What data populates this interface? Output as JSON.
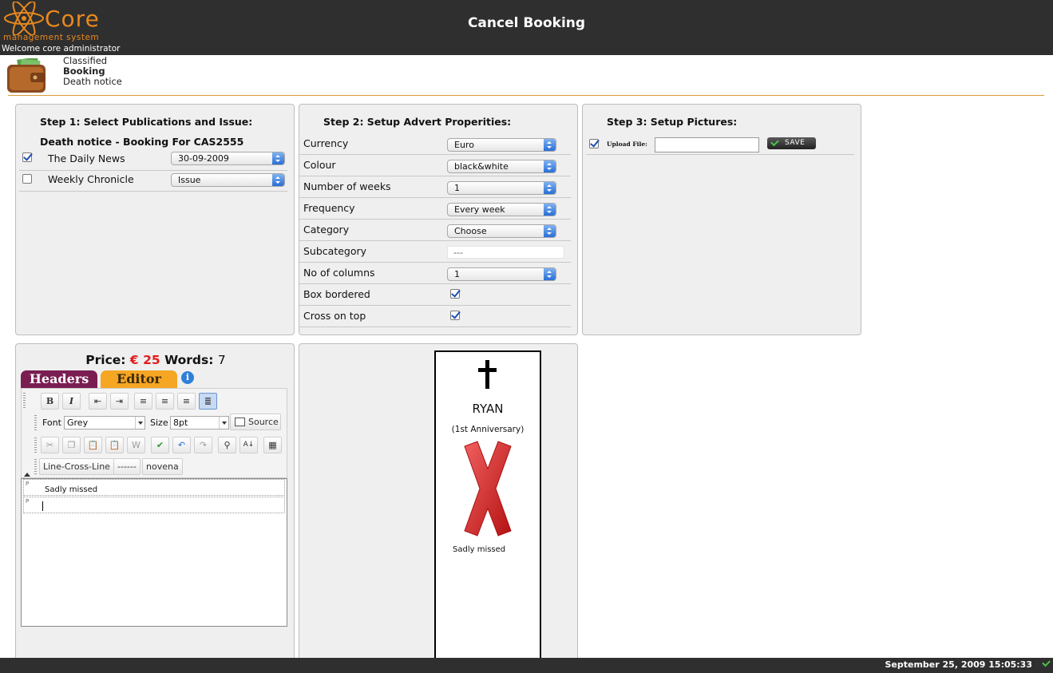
{
  "header": {
    "logo_text": "Core",
    "logo_subtitle": "management system",
    "welcome": "Welcome core administrator",
    "page_title": "Cancel Booking"
  },
  "breadcrumb": {
    "items": [
      "Classified",
      "Booking",
      "Death notice"
    ],
    "active_index": 1
  },
  "step1": {
    "title": "Step 1: Select Publications and Issue:",
    "subtitle": "Death notice - Booking For CAS2555",
    "publications": [
      {
        "name": "The Daily News",
        "checked": true,
        "issue": "30-09-2009"
      },
      {
        "name": "Weekly Chronicle",
        "checked": false,
        "issue": "Issue"
      }
    ]
  },
  "step2": {
    "title": "Step 2: Setup Advert Properities:",
    "currency": {
      "label": "Currency",
      "value": "Euro"
    },
    "colour": {
      "label": "Colour",
      "value": "black&white"
    },
    "weeks": {
      "label": "Number of weeks",
      "value": "1"
    },
    "frequency": {
      "label": "Frequency",
      "value": "Every week"
    },
    "category": {
      "label": "Category",
      "value": "Choose"
    },
    "subcategory": {
      "label": "Subcategory",
      "value": "---"
    },
    "columns": {
      "label": "No of columns",
      "value": "1"
    },
    "box_bordered": {
      "label": "Box bordered",
      "checked": true
    },
    "cross_on_top": {
      "label": "Cross on top",
      "checked": true
    }
  },
  "step3": {
    "title": "Step 3: Setup Pictures:",
    "upload_label": "Upload File:",
    "upload_checked": true,
    "save_label": "SAVE"
  },
  "editor": {
    "price_label": "Price:",
    "price_value": "€ 25",
    "words_label": "Words:",
    "words_value": "7",
    "tabs": [
      "Headers",
      "Editor"
    ],
    "active_tab": "Editor",
    "font_label": "Font",
    "font_value": "Grey",
    "size_label": "Size",
    "size_value": "8pt",
    "source_label": "Source",
    "templates": [
      "Line-Cross-Line",
      "------",
      "novena"
    ],
    "paragraphs": [
      "Sadly missed",
      ""
    ],
    "para_tag": "P"
  },
  "preview": {
    "name": "RYAN",
    "subtitle": "(1st Anniversary)",
    "message": "Sadly missed"
  },
  "footer": {
    "datetime": "September 25, 2009 15:05:33"
  },
  "colors": {
    "header_bg": "#2f2f2f",
    "brand_orange": "#e8891e",
    "price_red": "#e21b1b",
    "tab_headers": "#7a1e52",
    "tab_editor": "#f5a623"
  }
}
